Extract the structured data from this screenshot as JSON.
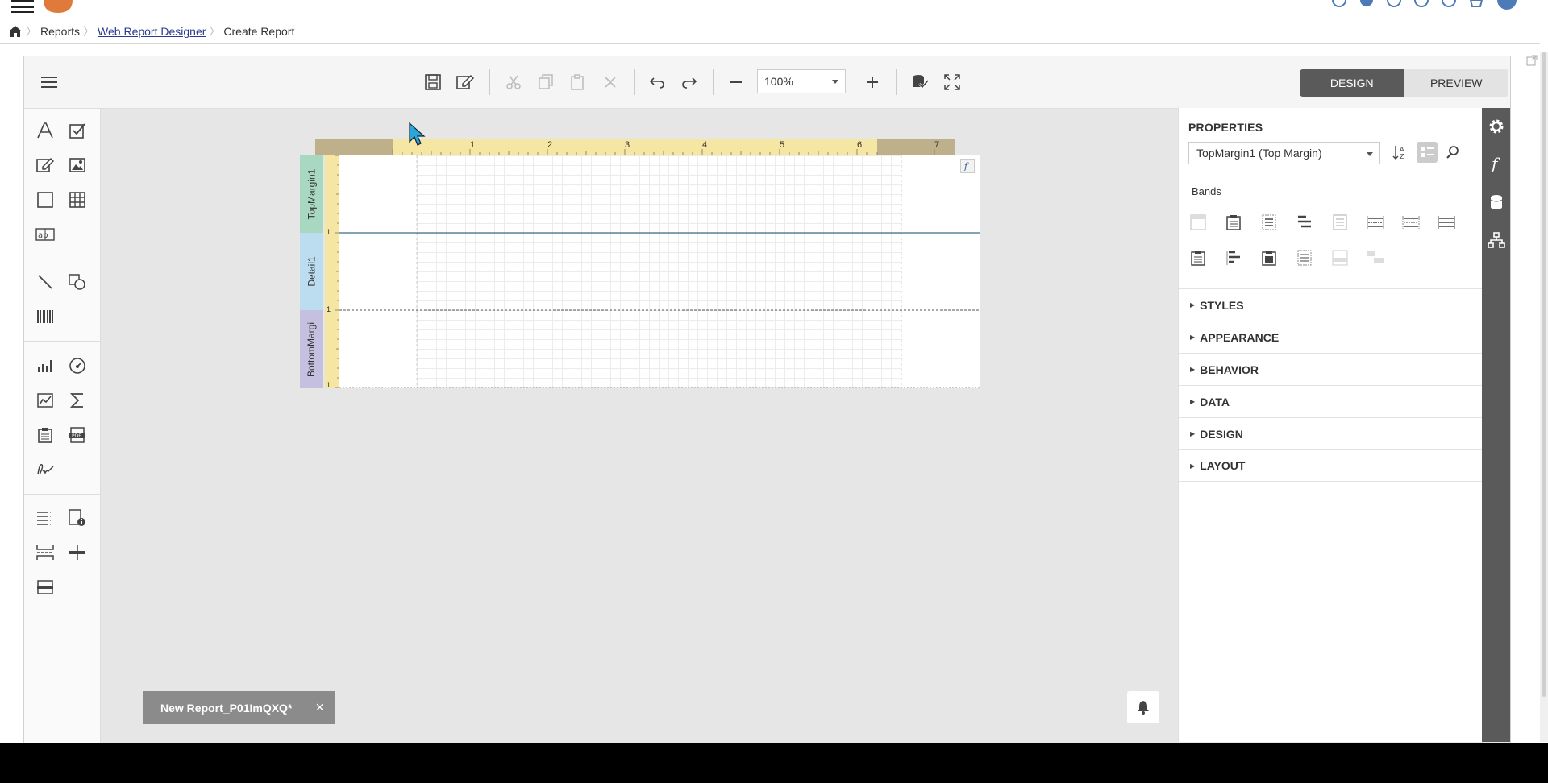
{
  "breadcrumb": {
    "home": "home",
    "items": [
      "Reports",
      "Web Report Designer",
      "Create Report"
    ]
  },
  "toolbar": {
    "zoom": "100%",
    "mode_design": "DESIGN",
    "mode_preview": "PREVIEW"
  },
  "ruler": {
    "ticks": [
      "1",
      "2",
      "3",
      "4",
      "5",
      "6",
      "7"
    ],
    "vticks": [
      "1",
      "1",
      "1"
    ]
  },
  "bands": {
    "top": "TopMargin1",
    "detail": "Detail1",
    "bottom": "BottomMargi"
  },
  "properties": {
    "title": "PROPERTIES",
    "selected": "TopMargin1 (Top Margin)",
    "bands_label": "Bands",
    "sections": [
      "STYLES",
      "APPEARANCE",
      "BEHAVIOR",
      "DATA",
      "DESIGN",
      "LAYOUT"
    ]
  },
  "document_tab": {
    "name": "New Report_P01ImQXQ*",
    "close": "×"
  },
  "colors": {
    "accent_dark": "#5a5a5a",
    "ruler": "#f6e6a3",
    "top_band": "#a8d8c0",
    "detail_band": "#bcdcef",
    "bottom_band": "#c6c0e0"
  }
}
